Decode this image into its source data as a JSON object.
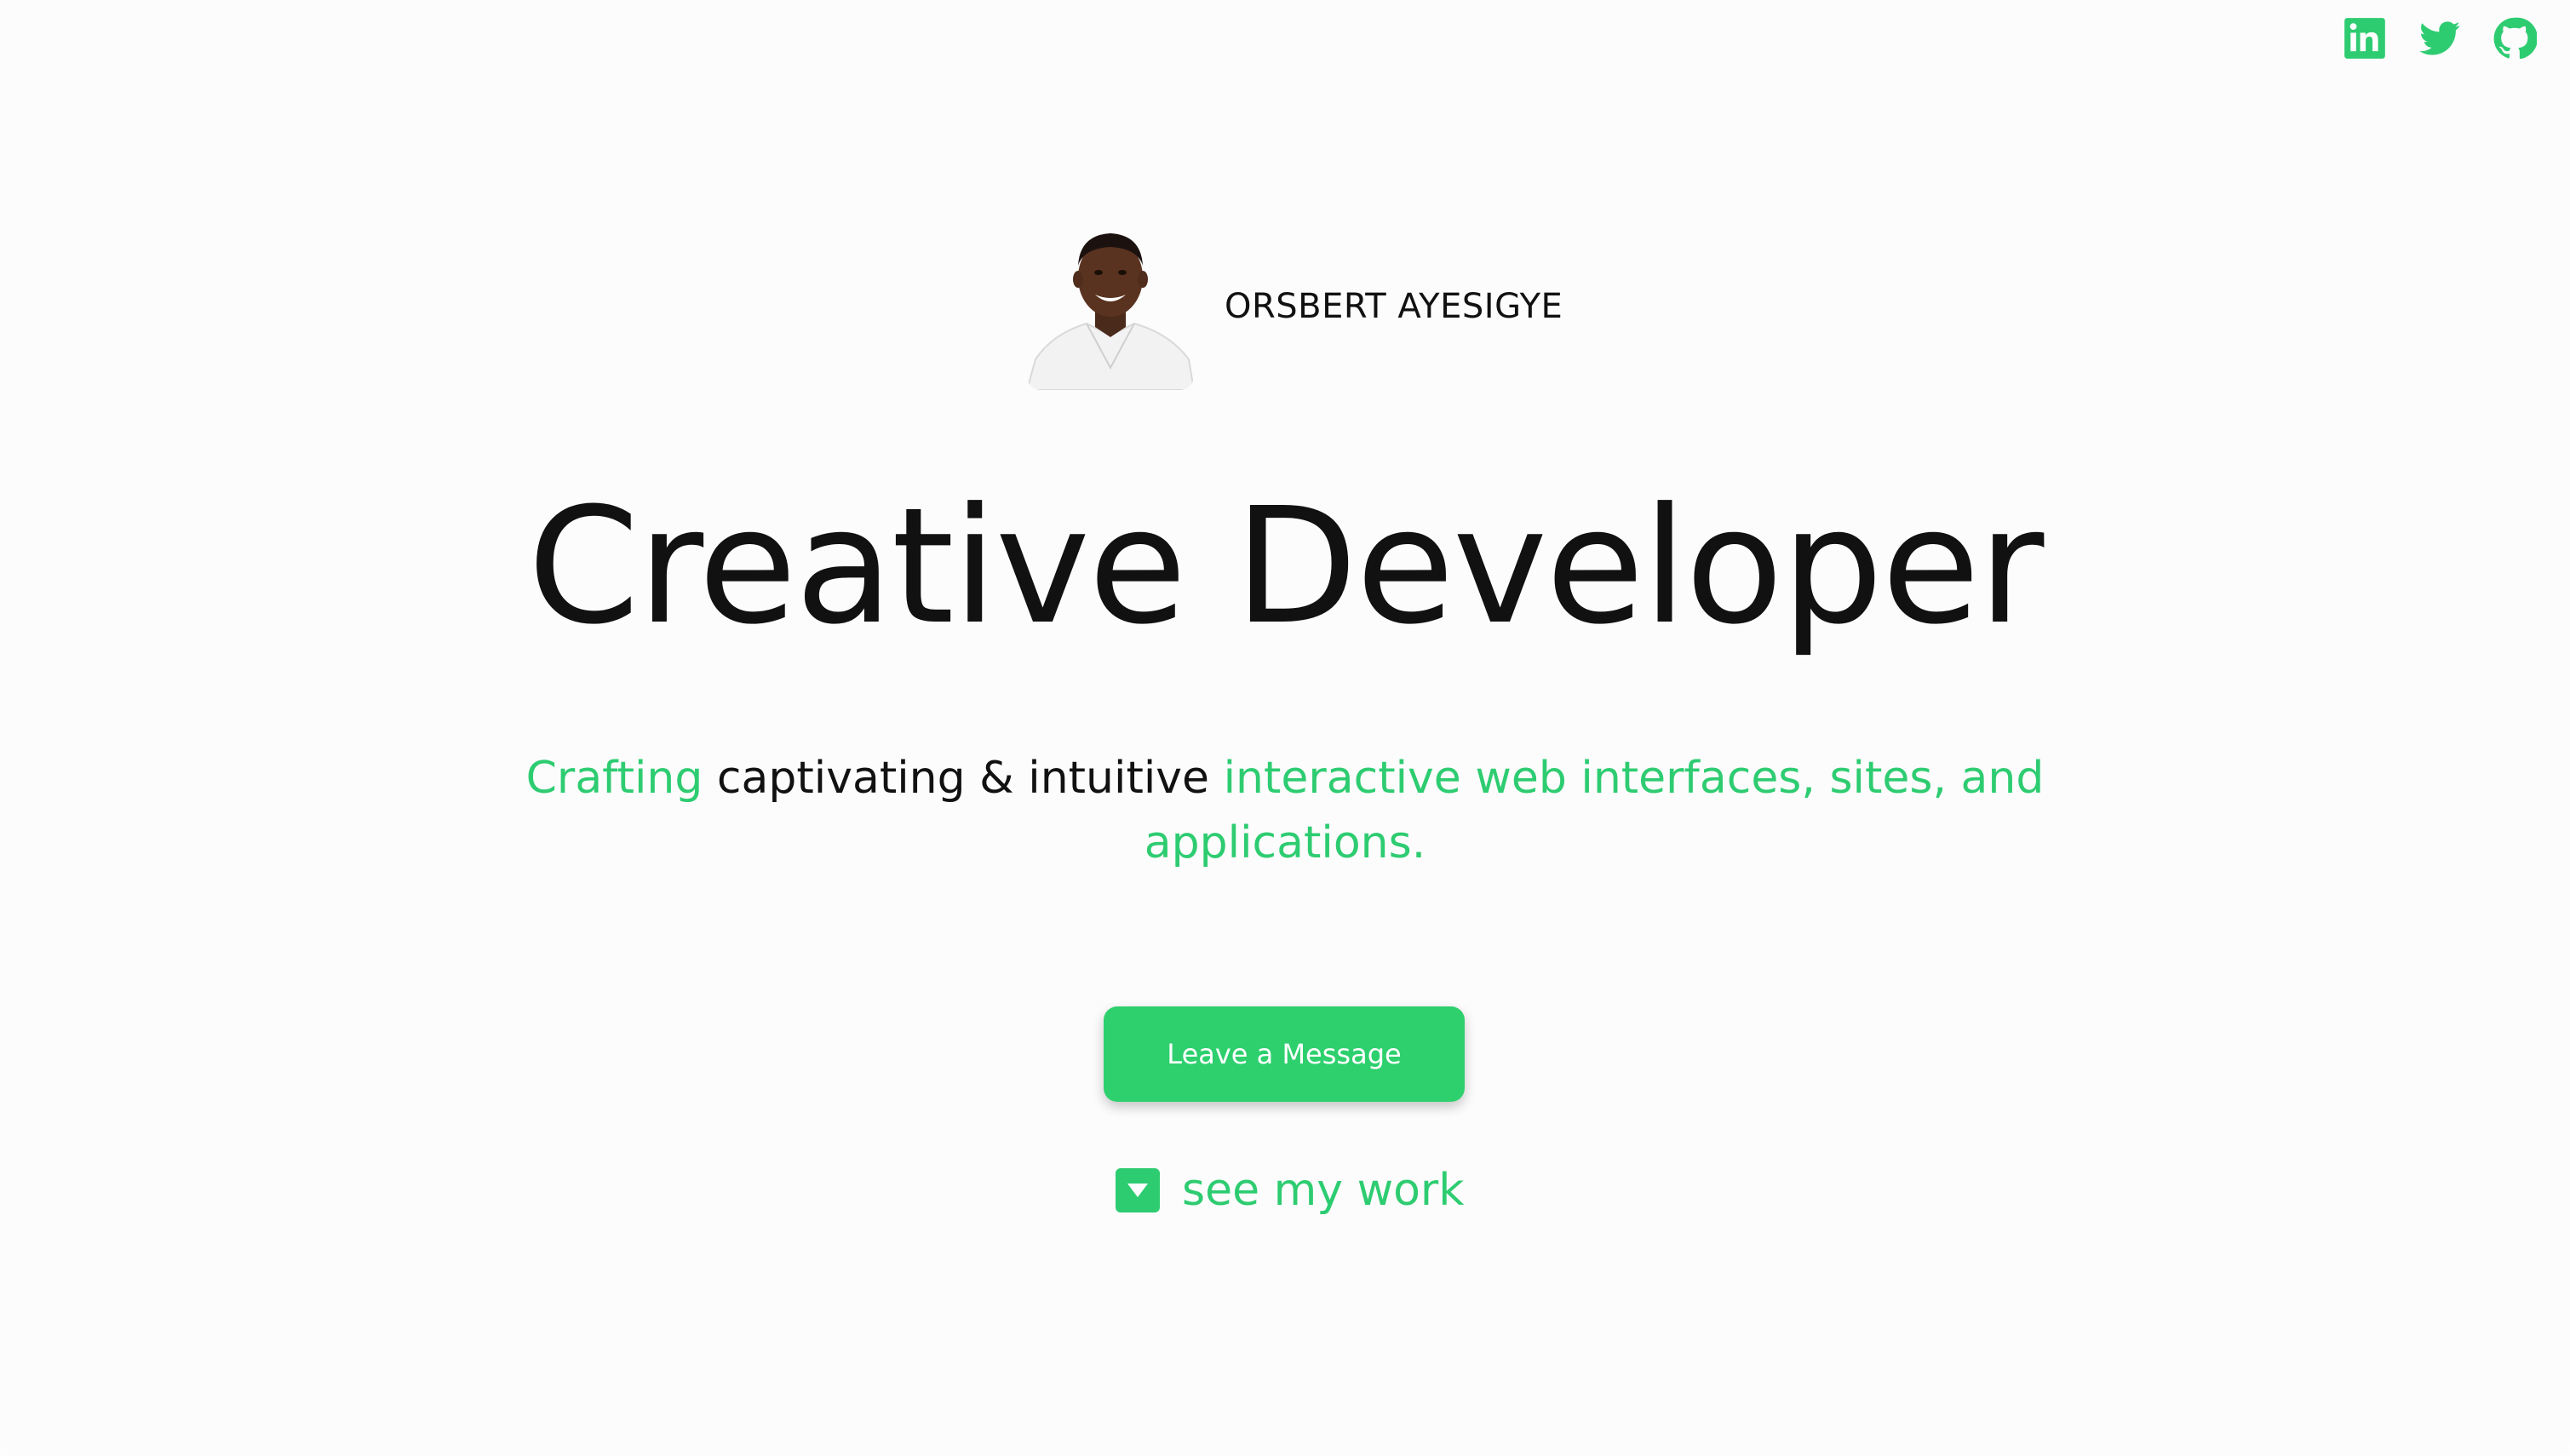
{
  "colors": {
    "accent": "#2ecc71",
    "text": "#111111",
    "background": "#fcfcfc"
  },
  "socials": [
    {
      "icon": "linkedin-icon"
    },
    {
      "icon": "twitter-icon"
    },
    {
      "icon": "github-icon"
    }
  ],
  "profile": {
    "name": "ORSBERT AYESIGYE"
  },
  "hero": {
    "headline": "Creative Developer",
    "tagline": {
      "part1": "Crafting",
      "part2": " captivating & intuitive ",
      "part3": "interactive web interfaces, sites, and applications."
    }
  },
  "cta": {
    "label": "Leave a Message"
  },
  "see_work": {
    "label": "see my work",
    "icon": "chevron-down-square-icon"
  }
}
